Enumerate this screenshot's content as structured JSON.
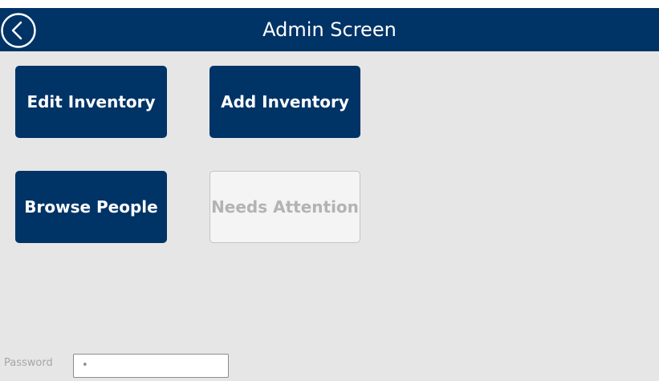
{
  "header": {
    "title": "Admin Screen",
    "back_icon": "chevron-left-circle-icon",
    "color": "#003366"
  },
  "tiles": {
    "edit_inventory": "Edit Inventory",
    "add_inventory": "Add Inventory",
    "browse_people": "Browse People",
    "needs_attention": "Needs Attention",
    "needs_attention_state": "disabled"
  },
  "password": {
    "label": "Password",
    "value": "•"
  },
  "colors": {
    "primary": "#003366",
    "background": "#e6e6e6",
    "disabled_text": "#b3b3b3"
  }
}
